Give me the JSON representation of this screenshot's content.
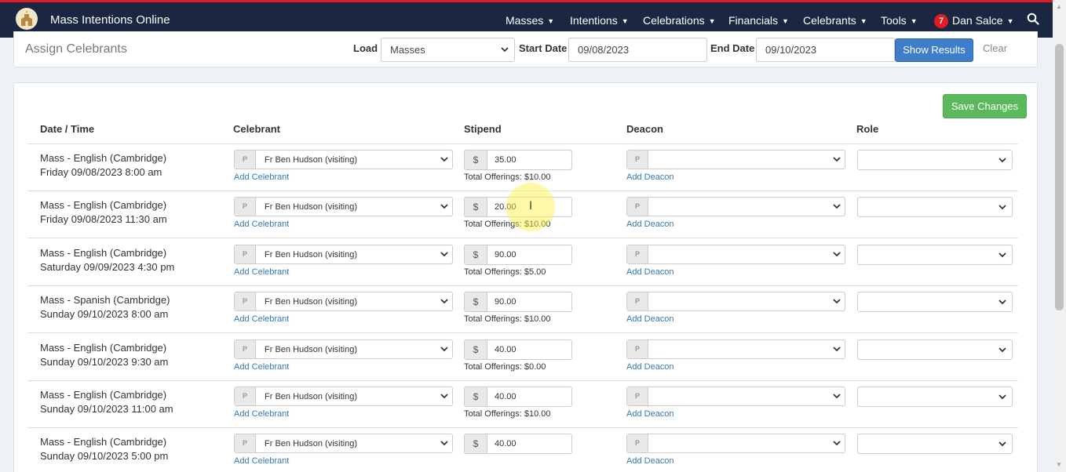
{
  "app": {
    "brand": "Mass Intentions Online",
    "nav": [
      "Masses",
      "Intentions",
      "Celebrations",
      "Financials",
      "Celebrants",
      "Tools"
    ],
    "user_name": "Dan Salce",
    "notifications": "7"
  },
  "toolbar": {
    "title": "Assign Celebrants",
    "load_label": "Load",
    "load_value": "Masses",
    "start_label": "Start Date",
    "start_value": "09/08/2023",
    "end_label": "End Date",
    "end_value": "09/10/2023",
    "show_results": "Show Results",
    "clear": "Clear"
  },
  "table": {
    "save_label": "Save Changes",
    "headers": {
      "datetime": "Date / Time",
      "celebrant": "Celebrant",
      "stipend": "Stipend",
      "deacon": "Deacon",
      "role": "Role"
    },
    "addon_p": "P",
    "addon_dollar": "$",
    "add_celebrant": "Add Celebrant",
    "add_deacon": "Add Deacon",
    "rows": [
      {
        "mass": "Mass - English (Cambridge)",
        "when": "Friday 09/08/2023 8:00 am",
        "celebrant": "Fr Ben Hudson (visiting)",
        "stipend": "35.00",
        "total": "Total Offerings: $10.00"
      },
      {
        "mass": "Mass - English (Cambridge)",
        "when": "Friday 09/08/2023 11:30 am",
        "celebrant": "Fr Ben Hudson (visiting)",
        "stipend": "20.00",
        "total": "Total Offerings: $10.00"
      },
      {
        "mass": "Mass - English (Cambridge)",
        "when": "Saturday 09/09/2023 4:30 pm",
        "celebrant": "Fr Ben Hudson (visiting)",
        "stipend": "90.00",
        "total": "Total Offerings: $5.00"
      },
      {
        "mass": "Mass - Spanish (Cambridge)",
        "when": "Sunday 09/10/2023 8:00 am",
        "celebrant": "Fr Ben Hudson (visiting)",
        "stipend": "90.00",
        "total": "Total Offerings: $10.00"
      },
      {
        "mass": "Mass - English (Cambridge)",
        "when": "Sunday 09/10/2023 9:30 am",
        "celebrant": "Fr Ben Hudson (visiting)",
        "stipend": "40.00",
        "total": "Total Offerings: $0.00"
      },
      {
        "mass": "Mass - English (Cambridge)",
        "when": "Sunday 09/10/2023 11:00 am",
        "celebrant": "Fr Ben Hudson (visiting)",
        "stipend": "40.00",
        "total": "Total Offerings: $10.00"
      },
      {
        "mass": "Mass - English (Cambridge)",
        "when": "Sunday 09/10/2023 5:00 pm",
        "celebrant": "Fr Ben Hudson (visiting)",
        "stipend": "40.00",
        "total": ""
      }
    ]
  }
}
